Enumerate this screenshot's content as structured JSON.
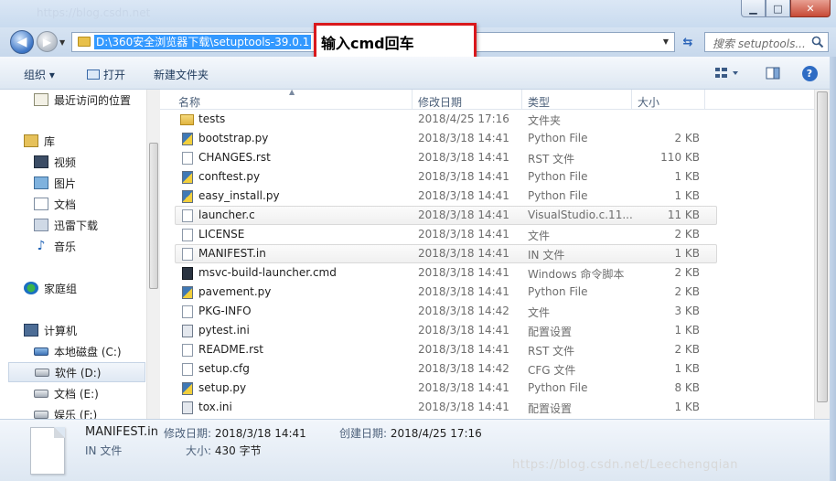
{
  "window": {
    "title": "https://blog.csdn.net"
  },
  "navbar": {
    "address_path": "D:\\360安全浏览器下载\\setuptools-39.0.1",
    "search_placeholder": "搜索 setuptools...",
    "annotation": "输入cmd回车"
  },
  "toolbar": {
    "organize_label": "组织 ▾",
    "open_label": "打开",
    "new_folder_label": "新建文件夹"
  },
  "sidebar": {
    "items": [
      {
        "label": "最近访问的位置",
        "icon": "recent-places-icon"
      },
      {
        "label": "库",
        "icon": "library-icon"
      },
      {
        "label": "视频",
        "icon": "video-icon"
      },
      {
        "label": "图片",
        "icon": "picture-icon"
      },
      {
        "label": "文档",
        "icon": "document-icon"
      },
      {
        "label": "迅雷下载",
        "icon": "download-icon"
      },
      {
        "label": "音乐",
        "icon": "music-icon"
      },
      {
        "label": "家庭组",
        "icon": "homegroup-icon"
      },
      {
        "label": "计算机",
        "icon": "computer-icon"
      },
      {
        "label": "本地磁盘 (C:)",
        "icon": "drive-c-icon"
      },
      {
        "label": "软件 (D:)",
        "icon": "drive-icon"
      },
      {
        "label": "文档 (E:)",
        "icon": "drive-icon"
      },
      {
        "label": "娱乐 (F:)",
        "icon": "drive-icon"
      }
    ]
  },
  "columns": {
    "name": "名称",
    "modified": "修改日期",
    "type": "类型",
    "size": "大小"
  },
  "files": [
    {
      "name": "tests",
      "modified": "2018/4/25 17:16",
      "type": "文件夹",
      "size": "",
      "icon": "folder"
    },
    {
      "name": "bootstrap.py",
      "modified": "2018/3/18 14:41",
      "type": "Python File",
      "size": "2 KB",
      "icon": "py"
    },
    {
      "name": "CHANGES.rst",
      "modified": "2018/3/18 14:41",
      "type": "RST 文件",
      "size": "110 KB",
      "icon": "doc"
    },
    {
      "name": "conftest.py",
      "modified": "2018/3/18 14:41",
      "type": "Python File",
      "size": "1 KB",
      "icon": "py"
    },
    {
      "name": "easy_install.py",
      "modified": "2018/3/18 14:41",
      "type": "Python File",
      "size": "1 KB",
      "icon": "py"
    },
    {
      "name": "launcher.c",
      "modified": "2018/3/18 14:41",
      "type": "VisualStudio.c.11...",
      "size": "11 KB",
      "icon": "doc"
    },
    {
      "name": "LICENSE",
      "modified": "2018/3/18 14:41",
      "type": "文件",
      "size": "2 KB",
      "icon": "doc"
    },
    {
      "name": "MANIFEST.in",
      "modified": "2018/3/18 14:41",
      "type": "IN 文件",
      "size": "1 KB",
      "icon": "doc"
    },
    {
      "name": "msvc-build-launcher.cmd",
      "modified": "2018/3/18 14:41",
      "type": "Windows 命令脚本",
      "size": "2 KB",
      "icon": "cmd"
    },
    {
      "name": "pavement.py",
      "modified": "2018/3/18 14:41",
      "type": "Python File",
      "size": "2 KB",
      "icon": "py"
    },
    {
      "name": "PKG-INFO",
      "modified": "2018/3/18 14:42",
      "type": "文件",
      "size": "3 KB",
      "icon": "doc"
    },
    {
      "name": "pytest.ini",
      "modified": "2018/3/18 14:41",
      "type": "配置设置",
      "size": "1 KB",
      "icon": "cfg"
    },
    {
      "name": "README.rst",
      "modified": "2018/3/18 14:41",
      "type": "RST 文件",
      "size": "2 KB",
      "icon": "doc"
    },
    {
      "name": "setup.cfg",
      "modified": "2018/3/18 14:42",
      "type": "CFG 文件",
      "size": "1 KB",
      "icon": "doc"
    },
    {
      "name": "setup.py",
      "modified": "2018/3/18 14:41",
      "type": "Python File",
      "size": "8 KB",
      "icon": "py"
    },
    {
      "name": "tox.ini",
      "modified": "2018/3/18 14:41",
      "type": "配置设置",
      "size": "1 KB",
      "icon": "cfg"
    }
  ],
  "details": {
    "name": "MANIFEST.in",
    "type": "IN 文件",
    "modified_label": "修改日期:",
    "modified_value": "2018/3/18 14:41",
    "created_label": "创建日期:",
    "created_value": "2018/4/25 17:16",
    "size_label": "大小:",
    "size_value": "430 字节"
  },
  "watermark": "https://blog.csdn.net/Leechengqian"
}
